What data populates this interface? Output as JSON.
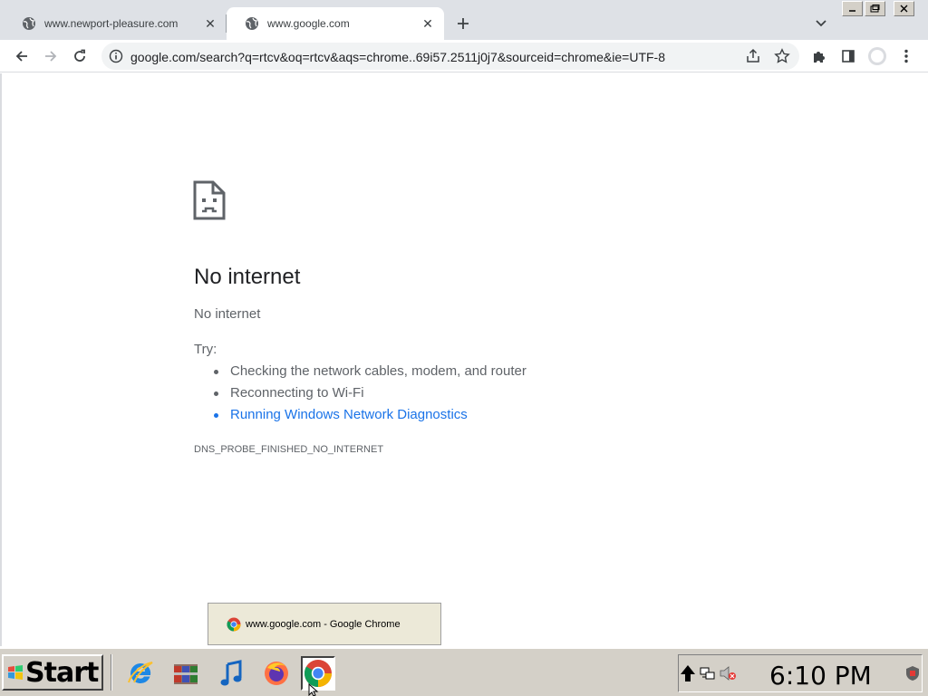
{
  "browser": {
    "tabs": [
      {
        "title": "www.newport-pleasure.com",
        "active": false
      },
      {
        "title": "www.google.com",
        "active": true
      }
    ],
    "address": "google.com/search?q=rtcv&oq=rtcv&aqs=chrome..69i57.2511j0j7&sourceid=chrome&ie=UTF-8"
  },
  "error_page": {
    "heading": "No internet",
    "subheading": "No internet",
    "try_label": "Try:",
    "suggestions": [
      "Checking the network cables, modem, and router",
      "Reconnecting to Wi-Fi",
      "Running Windows Network Diagnostics"
    ],
    "error_code": "DNS_PROBE_FINISHED_NO_INTERNET"
  },
  "tooltip": {
    "text": "www.google.com - Google Chrome"
  },
  "taskbar": {
    "start_label": "Start",
    "pinned_icons": [
      "internet-explorer-icon",
      "archive-icon",
      "music-icon",
      "firefox-icon",
      "chrome-icon"
    ],
    "clock": "6:10 PM"
  },
  "colors": {
    "link": "#1a73e8",
    "text_secondary": "#5f6368",
    "tabstrip": "#dee1e6",
    "taskbar": "#d4d0c8"
  }
}
